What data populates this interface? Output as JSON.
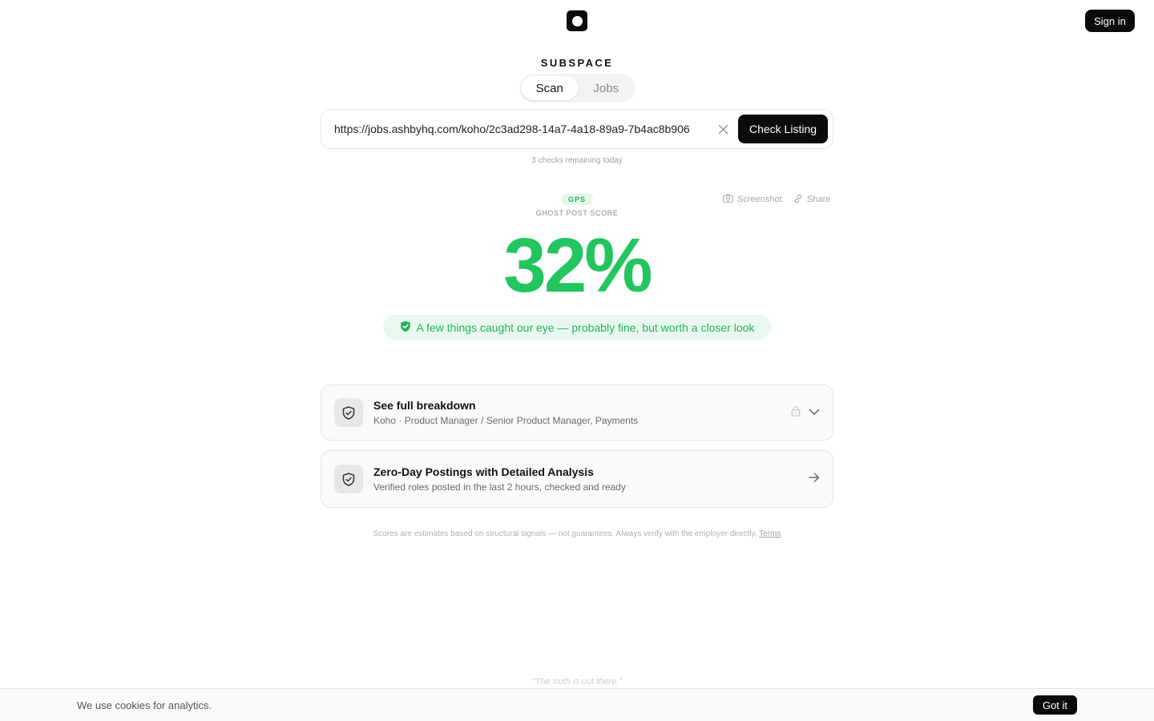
{
  "header": {
    "logo_icon": "app-logo-icon",
    "sign_in_label": "Sign in"
  },
  "brand": "SUBSPACE",
  "tabs": [
    {
      "label": "Scan",
      "active": true
    },
    {
      "label": "Jobs",
      "active": false
    }
  ],
  "search": {
    "value": "https://jobs.ashbyhq.com/koho/2c3ad298-14a7-4a18-89a9-7b4ac8b906",
    "clear_icon": "close-icon",
    "submit_label": "Check Listing",
    "remaining_text": "3 checks remaining today"
  },
  "result": {
    "badge": "GPS",
    "score_label": "GHOST POST SCORE",
    "score": "32%",
    "verdict": "A few things caught our eye — probably fine, but worth a closer look",
    "actions": {
      "screenshot_label": "Screenshot",
      "share_label": "Share"
    }
  },
  "cards": [
    {
      "title": "See full breakdown",
      "subtitle": "Koho · Product Manager / Senior Product Manager, Payments",
      "icon": "shield-check-icon"
    },
    {
      "title": "Zero-Day Postings with Detailed Analysis",
      "subtitle": "Verified roles posted in the last 2 hours, checked and ready",
      "icon": "shield-check-icon"
    }
  ],
  "disclaimer": {
    "text": "Scores are estimates based on structural signals — not guarantees. Always verify with the employer directly.",
    "link_label": "Terms"
  },
  "quote": "“The truth is out there.”",
  "cookie": {
    "message": "We use cookies for analytics.",
    "accept_label": "Got it"
  },
  "colors": {
    "accent_green": "#22c55e",
    "primary_dark": "#0b0b0b"
  }
}
